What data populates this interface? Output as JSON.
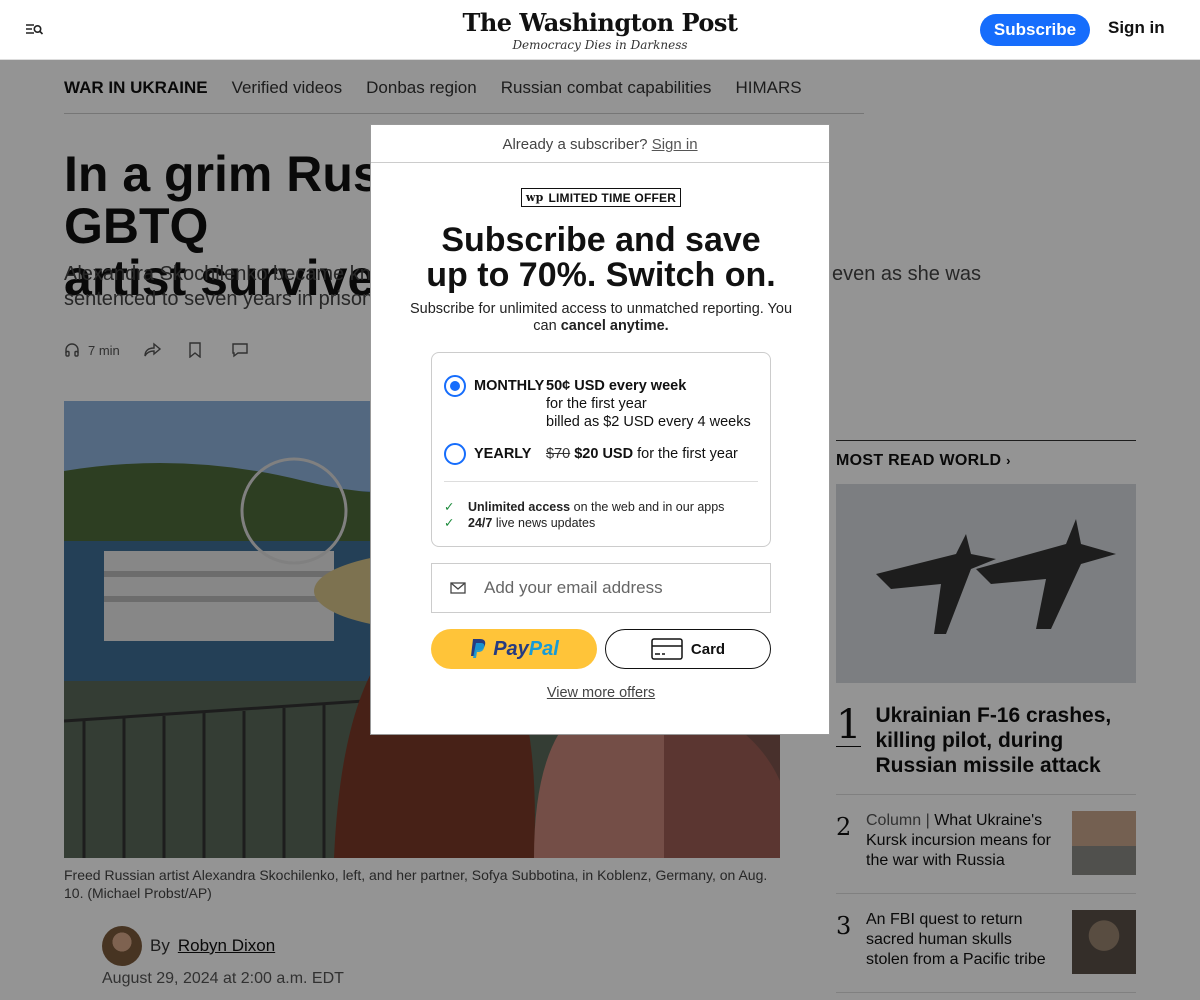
{
  "header": {
    "logo": "The Washington Post",
    "tagline": "Democracy Dies in Darkness",
    "subscribe_label": "Subscribe",
    "signin_label": "Sign in"
  },
  "subnav": {
    "items": [
      "WAR IN UKRAINE",
      "Verified videos",
      "Donbas region",
      "Russian combat capabilities",
      "HIMARS"
    ]
  },
  "article": {
    "headline": "In a grim Rus…GBTQ artist survive…",
    "headline_left": "In a grim Rus",
    "headline_right": "GBTQ",
    "headline_line2": "artist survive",
    "dek_left_1": "Alexandra Skochilenko became kn",
    "dek_right_1": ", even as she was",
    "dek_left_2": "sentenced to seven years in prison",
    "listen_time": "7 min",
    "caption": "Freed Russian artist Alexandra Skochilenko, left, and her partner, Sofya Subbotina, in Koblenz, Germany, on Aug. 10. (Michael Probst/AP)",
    "by_prefix": "By",
    "author": "Robyn Dixon",
    "date": "August 29, 2024 at 2:00 a.m. EDT"
  },
  "most_read": {
    "title": "MOST READ WORLD",
    "items": [
      {
        "num": "1",
        "kicker": "",
        "headline": "Ukrainian F-16 crashes, killing pilot, during Russian missile attack"
      },
      {
        "num": "2",
        "kicker": "Column | ",
        "headline": "What Ukraine's Kursk incursion means for the war with Russia"
      },
      {
        "num": "3",
        "kicker": "",
        "headline": "An FBI quest to return sacred human skulls stolen from a Pacific tribe"
      }
    ]
  },
  "modal": {
    "already_text": "Already a subscriber?",
    "signin_link": "Sign in",
    "badge": "LIMITED TIME OFFER",
    "badge_logo": "wp",
    "title_line1": "Subscribe and save",
    "title_line2": "up to 70%. Switch on.",
    "sub_text": "Subscribe for unlimited access to unmatched reporting. You can",
    "sub_bold": "cancel anytime.",
    "plans": [
      {
        "name": "MONTHLY",
        "price": "50¢ USD every week",
        "line2": "for the first year",
        "line3": "billed as $2 USD every 4 weeks",
        "selected": true
      },
      {
        "name": "YEARLY",
        "old_price": "$70",
        "price": "$20 USD",
        "suffix": "for the first year",
        "selected": false
      }
    ],
    "features": [
      {
        "bold": "Unlimited access",
        "rest": "on the web and in our apps"
      },
      {
        "bold": "24/7",
        "rest": "live news updates"
      }
    ],
    "email_placeholder": "Add your email address",
    "paypal_label_1": "Pay",
    "paypal_label_2": "Pal",
    "card_label": "Card",
    "more_offers": "View more offers"
  },
  "colors": {
    "accent": "#166dfc",
    "paypal": "#ffc439"
  }
}
